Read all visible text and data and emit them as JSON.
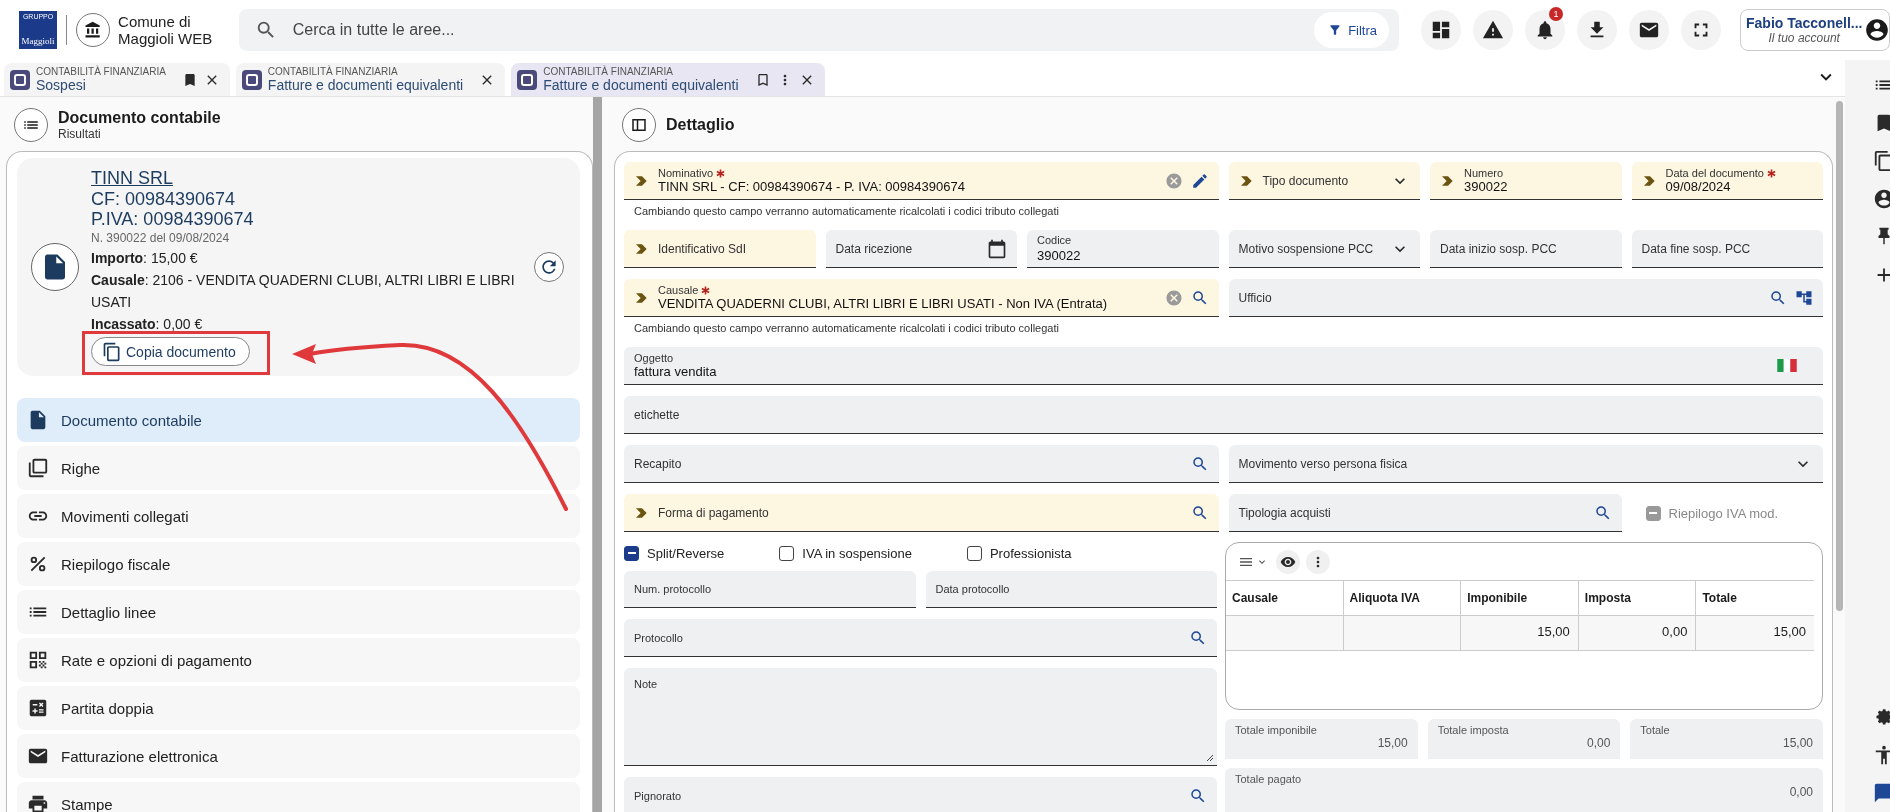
{
  "header": {
    "logo": {
      "caption": "GRUPPO",
      "name": "Maggioli"
    },
    "app_name": "Comune di Maggioli WEB",
    "search": {
      "placeholder": "Cerca in tutte le aree..."
    },
    "filter_button": "Filtra",
    "notifications": "1",
    "user": {
      "name": "Fabio Tacconell...",
      "subtitle": "Il tuo account"
    }
  },
  "tabs": [
    {
      "category": "CONTABILITÀ FINANZIARIA",
      "title": "Sospesi",
      "selected": false,
      "bookmarked": true
    },
    {
      "category": "CONTABILITÀ FINANZIARIA",
      "title": "Fatture e documenti equivalenti",
      "selected": false,
      "bookmarked": false
    },
    {
      "category": "CONTABILITÀ FINANZIARIA",
      "title": "Fatture e documenti equivalenti",
      "selected": true,
      "bookmarked": false
    }
  ],
  "results_panel": {
    "title": "Documento contabile",
    "subtitle": "Risultati",
    "summary": {
      "name": "TINN SRL",
      "cf": "CF: 00984390674",
      "piva": "P.IVA: 00984390674",
      "reference": "N. 390022 del 09/08/2024",
      "details": [
        "**Importo**: 15,00 €",
        "**Causale**: 2106 - VENDITA QUADERNI CLUBI, ALTRI LIBRI E LIBRI USATI",
        "**Incassato**: 0,00 €"
      ],
      "copy_button": "Copia documento"
    },
    "menu": [
      {
        "label": "Documento contabile",
        "selected": true
      },
      {
        "label": "Righe",
        "selected": false
      },
      {
        "label": "Movimenti collegati",
        "selected": false
      },
      {
        "label": "Riepilogo fiscale",
        "selected": false
      },
      {
        "label": "Dettaglio linee",
        "selected": false
      },
      {
        "label": "Rate e opzioni di pagamento",
        "selected": false
      },
      {
        "label": "Partita doppia",
        "selected": false
      },
      {
        "label": "Fatturazione elettronica",
        "selected": false
      },
      {
        "label": "Stampe",
        "selected": false
      }
    ]
  },
  "detail": {
    "title": "Dettaglio",
    "fields": [
      {
        "label": "Nominativo",
        "value": "TINN SRL - CF: 00984390674 - P. IVA: 00984390674",
        "kind": "clear-edit",
        "required": true,
        "highlighted": true,
        "hint": "Cambiando questo campo verranno automaticamente ricalcolati i codici tributo collegati"
      },
      {
        "label": "Tipo documento",
        "kind": "select",
        "required": false,
        "highlighted": true
      },
      {
        "label": "Numero",
        "value": "390022",
        "kind": "text",
        "required": false,
        "highlighted": true
      },
      {
        "label": "Data del documento",
        "value": "09/08/2024",
        "kind": "text",
        "required": true,
        "highlighted": true
      },
      {
        "label": "Identificativo SdI",
        "kind": "text",
        "required": false,
        "highlighted": true
      },
      {
        "label": "Data ricezione",
        "kind": "date",
        "required": false,
        "highlighted": false
      },
      {
        "label": "Codice",
        "value": "390022",
        "kind": "number",
        "required": false,
        "highlighted": false
      },
      {
        "label": "Motivo sospensione PCC",
        "kind": "select",
        "required": false,
        "highlighted": false
      },
      {
        "label": "Data inizio sosp. PCC",
        "kind": "text",
        "required": false,
        "highlighted": false
      },
      {
        "label": "Data fine sosp. PCC",
        "kind": "text",
        "required": false,
        "highlighted": false
      },
      {
        "label": "Causale",
        "value": "VENDITA QUADERNI CLUBI, ALTRI LIBRI E LIBRI USATI - Non IVA (Entrata)",
        "kind": "clear-search",
        "required": true,
        "highlighted": true,
        "hint": "Cambiando questo campo verranno automaticamente ricalcolati i codici tributo collegati"
      },
      {
        "label": "Ufficio",
        "kind": "search-tree",
        "required": false,
        "highlighted": false
      },
      {
        "label": "Oggetto",
        "value": "fattura vendita",
        "kind": "flag",
        "required": false,
        "highlighted": false
      },
      {
        "label": "etichette",
        "kind": "text",
        "required": false,
        "highlighted": false
      },
      {
        "label": "Recapito",
        "kind": "search",
        "required": false,
        "highlighted": false
      },
      {
        "label": "Movimento verso persona fisica",
        "kind": "select",
        "required": false,
        "highlighted": false
      },
      {
        "label": "Forma di pagamento",
        "kind": "search",
        "required": false,
        "highlighted": true
      },
      {
        "label": "Tipologia acquisti",
        "kind": "search",
        "required": false,
        "highlighted": false
      },
      {
        "label": "Riepilogo IVA mod.",
        "kind": "checkbox",
        "checked": true,
        "disabled": true
      }
    ],
    "options": [
      {
        "label": "Split/Reverse",
        "checked": true
      },
      {
        "label": "IVA in sospensione",
        "checked": false
      },
      {
        "label": "Professionista",
        "checked": false
      }
    ],
    "protocol_fields": [
      {
        "label": "Num. protocollo",
        "kind": "text"
      },
      {
        "label": "Data protocollo",
        "kind": "text"
      },
      {
        "label": "Protocollo",
        "kind": "search"
      },
      {
        "label": "Note",
        "kind": "textarea"
      },
      {
        "label": "Pignorato",
        "kind": "search"
      }
    ],
    "vat_table": {
      "columns": [
        "Causale",
        "Aliquota IVA",
        "Imponibile",
        "Imposta",
        "Totale"
      ],
      "rows": [
        {
          "cells": [
            null,
            null,
            "15,00",
            "0,00",
            "15,00"
          ]
        }
      ]
    },
    "totals": [
      {
        "label": "Totale imponibile",
        "value": "15,00"
      },
      {
        "label": "Totale imposta",
        "value": "0,00"
      },
      {
        "label": "Totale",
        "value": "15,00"
      }
    ],
    "total_paid": {
      "label": "Totale pagato",
      "value": "0,00"
    }
  }
}
